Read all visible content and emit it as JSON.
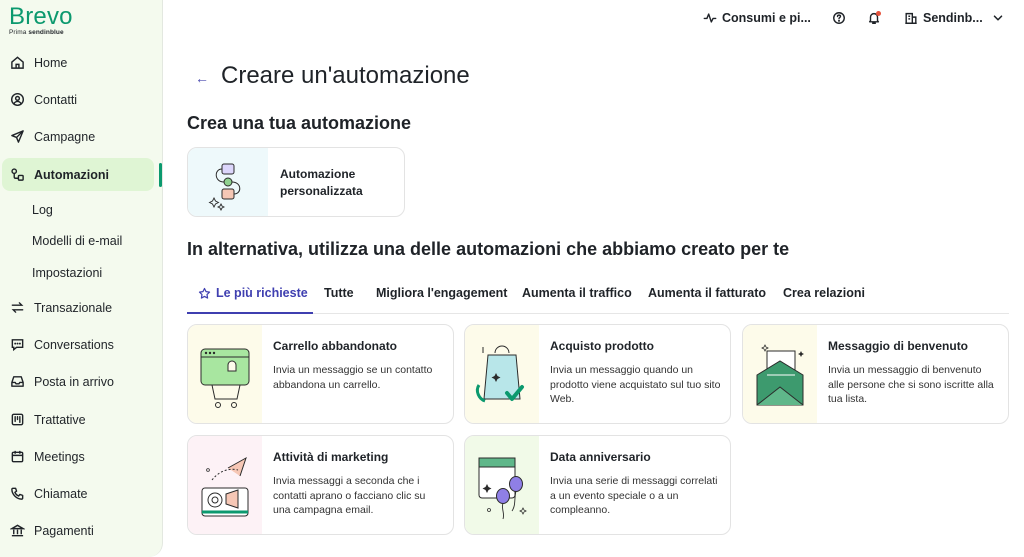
{
  "logo": {
    "word": "Brevo",
    "sub_prefix": "Prima",
    "sub_brand": "sendinblue"
  },
  "sidebar": {
    "items": [
      {
        "label": "Home",
        "icon": "home-icon"
      },
      {
        "label": "Contatti",
        "icon": "contacts-icon"
      },
      {
        "label": "Campagne",
        "icon": "send-icon"
      },
      {
        "label": "Automazioni",
        "icon": "automation-icon"
      },
      {
        "label": "Transazionale",
        "icon": "transactional-icon"
      },
      {
        "label": "Conversations",
        "icon": "chat-icon"
      },
      {
        "label": "Posta in arrivo",
        "icon": "inbox-icon"
      },
      {
        "label": "Trattative",
        "icon": "deals-icon"
      },
      {
        "label": "Meetings",
        "icon": "calendar-icon"
      },
      {
        "label": "Chiamate",
        "icon": "phone-icon"
      },
      {
        "label": "Pagamenti",
        "icon": "bank-icon"
      }
    ],
    "sub_items": [
      {
        "label": "Log"
      },
      {
        "label": "Modelli di e-mail"
      },
      {
        "label": "Impostazioni"
      }
    ]
  },
  "topbar": {
    "usage_label": "Consumi e pi...",
    "account_label": "Sendinb..."
  },
  "page": {
    "back_glyph": "←",
    "title": "Creare un'automazione",
    "section_custom": "Crea una tua automazione",
    "custom_card_label": "Automazione personalizzata",
    "section_templates": "In alternativa, utilizza una delle automazioni che abbiamo creato per te"
  },
  "tabs": [
    {
      "label": "Le più richieste"
    },
    {
      "label": "Tutte"
    },
    {
      "label": "Migliora l'engagement"
    },
    {
      "label": "Aumenta il traffico"
    },
    {
      "label": "Aumenta il fatturato"
    },
    {
      "label": "Crea relazioni"
    }
  ],
  "cards": [
    {
      "title": "Carrello abbandonato",
      "desc": "Invia un messaggio se un contatto abbandona un carrello.",
      "bg": "#fdfbea"
    },
    {
      "title": "Acquisto prodotto",
      "desc": "Invia un messaggio quando un prodotto viene acquistato sul tuo sito Web.",
      "bg": "#fdfbea"
    },
    {
      "title": "Messaggio di benvenuto",
      "desc": "Invia un messaggio di benvenuto alle persone che si sono iscritte alla tua lista.",
      "bg": "#fdfbea"
    },
    {
      "title": "Attività di marketing",
      "desc": "Invia messaggi a seconda che i contatti aprano o facciano clic su una campagna email.",
      "bg": "#fdf2f6"
    },
    {
      "title": "Data anniversario",
      "desc": "Invia una serie di messaggi correlati a un evento speciale o a un compleanno.",
      "bg": "#f1fae8"
    }
  ],
  "colors": {
    "brand": "#0b996e",
    "accent": "#3f3fb0",
    "sidebar_bg": "#f4faee",
    "active_bg": "#dff5d4"
  }
}
